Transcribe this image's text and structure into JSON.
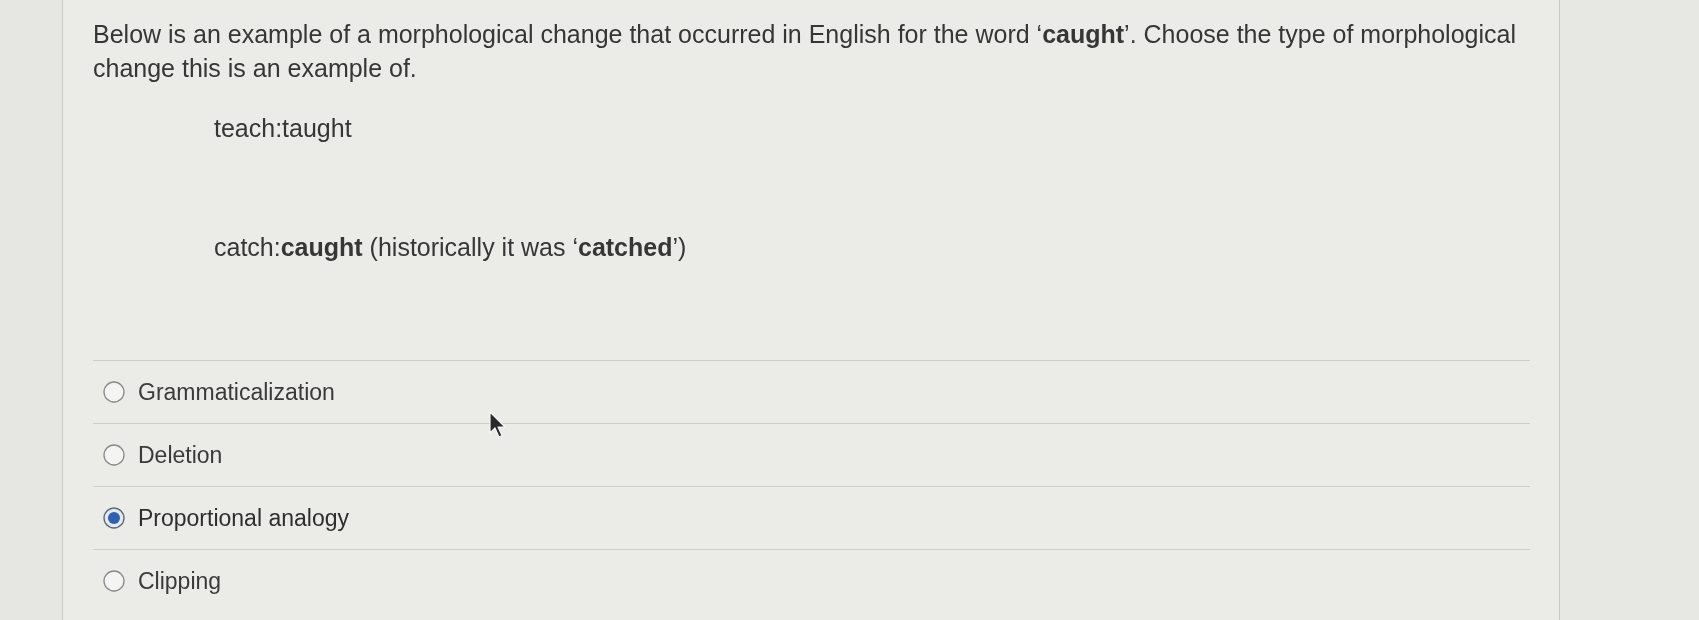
{
  "question": {
    "text": "Below is an example of a morphological change that occurred in English for the word ‘**caught**’. Choose the type of morphological change this is an example of."
  },
  "examples": [
    "teach:taught",
    "catch:**caught** (historically it was ‘**catched**’)"
  ],
  "options": [
    {
      "label": "Grammaticalization",
      "selected": false
    },
    {
      "label": "Deletion",
      "selected": false
    },
    {
      "label": "Proportional analogy",
      "selected": true
    },
    {
      "label": "Clipping",
      "selected": false
    }
  ]
}
